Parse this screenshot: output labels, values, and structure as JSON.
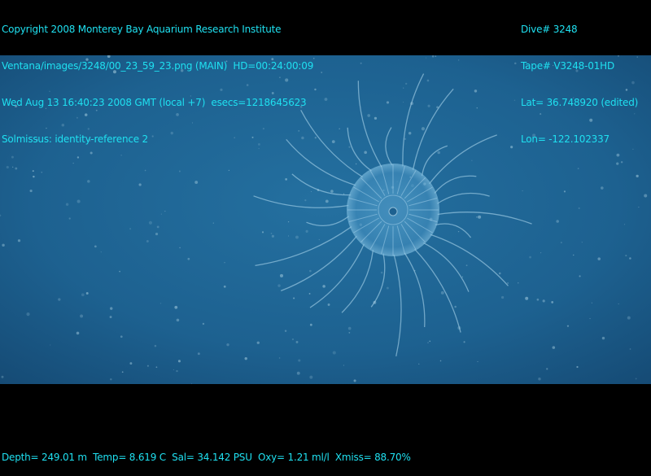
{
  "header_left": {
    "copyright": "Copyright 2008 Monterey Bay Aquarium Research Institute",
    "image_path": "Ventana/images/3248/00_23_59_23.png (MAIN)  HD=00:24:00:09",
    "datetime": "Wed Aug 13 16:40:23 2008 GMT (local +7)  esecs=1218645623",
    "annotation": "Solmissus: identity-reference 2"
  },
  "header_right": {
    "dive": "Dive# 3248",
    "tape": "Tape# V3248-01HD",
    "lat": "Lat= 36.748920 (edited)",
    "lon": "Lon= -122.102337"
  },
  "footer": {
    "sensors": "Depth= 249.01 m  Temp= 8.619 C  Sal= 34.142 PSU  Oxy= 1.21 ml/l  Xmiss= 88.70%"
  },
  "colors": {
    "overlay_text": "#1fe0f0",
    "water": "#1f5f88"
  }
}
